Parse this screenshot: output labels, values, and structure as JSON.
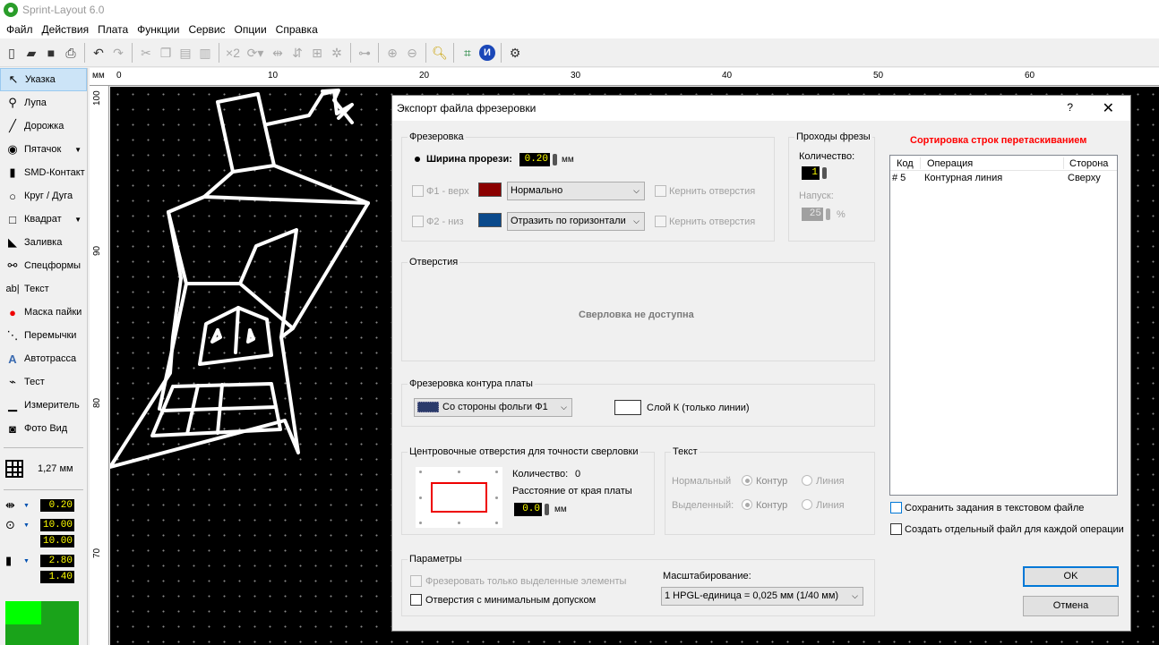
{
  "app": {
    "title": "Sprint-Layout 6.0"
  },
  "menu": [
    "Файл",
    "Действия",
    "Плата",
    "Функции",
    "Сервис",
    "Опции",
    "Справка"
  ],
  "toolbar": {
    "labels": {
      "mirror_x2": "×2"
    }
  },
  "tools": [
    {
      "label": "Указка",
      "icon": "pointer-icon"
    },
    {
      "label": "Лупа",
      "icon": "magnifier-icon"
    },
    {
      "label": "Дорожка",
      "icon": "track-icon"
    },
    {
      "label": "Пятачок",
      "icon": "pad-icon"
    },
    {
      "label": "SMD-Контакт",
      "icon": "smd-icon"
    },
    {
      "label": "Круг / Дуга",
      "icon": "circle-icon"
    },
    {
      "label": "Квадрат",
      "icon": "square-icon"
    },
    {
      "label": "Заливка",
      "icon": "fill-icon"
    },
    {
      "label": "Спецформы",
      "icon": "special-forms-icon"
    },
    {
      "label": "Текст",
      "icon": "text-icon"
    },
    {
      "label": "Маска пайки",
      "icon": "solder-mask-icon"
    },
    {
      "label": "Перемычки",
      "icon": "jumper-icon"
    },
    {
      "label": "Автотрасса",
      "icon": "autoroute-icon"
    },
    {
      "label": "Тест",
      "icon": "test-icon"
    },
    {
      "label": "Измеритель",
      "icon": "ruler-icon"
    },
    {
      "label": "Фото Вид",
      "icon": "photo-view-icon"
    }
  ],
  "grid": {
    "label": "1,27 мм"
  },
  "values": {
    "track_width": "0.20",
    "pad_outer": "10.00",
    "pad_inner": "10.00",
    "smd_w": "2.80",
    "smd_h": "1.40"
  },
  "ruler": {
    "unit": "мм",
    "top_labels": [
      "0",
      "10",
      "20",
      "30",
      "40",
      "50",
      "60"
    ],
    "left_labels": [
      "100",
      "90",
      "80",
      "70"
    ]
  },
  "dialog": {
    "title": "Экспорт файла фрезеровки",
    "help": "?",
    "close": "✕",
    "milling": {
      "title": "Фрезеровка",
      "cut_width_label": "Ширина прорези:",
      "cut_width_value": "0.20",
      "unit_mm": "мм",
      "f1_label": "Ф1 - верх",
      "f1_color": "#8b0000",
      "f1_mode": "Нормально",
      "f1_drill": "Кернить отверстия",
      "f2_label": "Ф2 - низ",
      "f2_color": "#0a4a8c",
      "f2_mode": "Отразить по горизонтали",
      "f2_drill": "Кернить отверстия"
    },
    "passes": {
      "title": "Проходы фрезы",
      "count_label": "Количество:",
      "count_value": "1",
      "overlap_label": "Напуск:",
      "overlap_value": "25",
      "percent": "%"
    },
    "holes": {
      "title": "Отверстия",
      "message": "Сверловка не доступна"
    },
    "outline": {
      "title": "Фрезеровка контура платы",
      "side_value": "Со стороны фольги Ф1",
      "layer_label": "Слой К (только линии)"
    },
    "center_holes": {
      "title": "Центровочные отверстия для точности сверловки",
      "count_label": "Количество:",
      "count_value": "0",
      "distance_label": "Расстояние от края платы",
      "distance_value": "0.0",
      "unit_mm": "мм"
    },
    "text": {
      "title": "Текст",
      "normal_label": "Нормальный",
      "selected_label": "Выделенный:",
      "contour": "Контур",
      "line": "Линия"
    },
    "params": {
      "title": "Параметры",
      "only_selected": "Фрезеровать только выделенные элементы",
      "min_tolerance": "Отверстия с минимальным допуском",
      "scale_label": "Масштабирование:",
      "scale_value": "1 HPGL-единица = 0,025 мм (1/40 мм)"
    },
    "sort": {
      "hint": "Сортировка строк перетаскиванием",
      "hint_color": "#ff0000",
      "col_code": "Код",
      "col_operation": "Операция",
      "col_side": "Сторона",
      "rows": [
        {
          "code": "# 5",
          "operation": "Контурная линия",
          "side": "Сверху"
        }
      ]
    },
    "save_text": "Сохранить задания в текстовом файле",
    "separate_file": "Создать отдельный файл для каждой операции",
    "ok": "OK",
    "cancel": "Отмена"
  }
}
